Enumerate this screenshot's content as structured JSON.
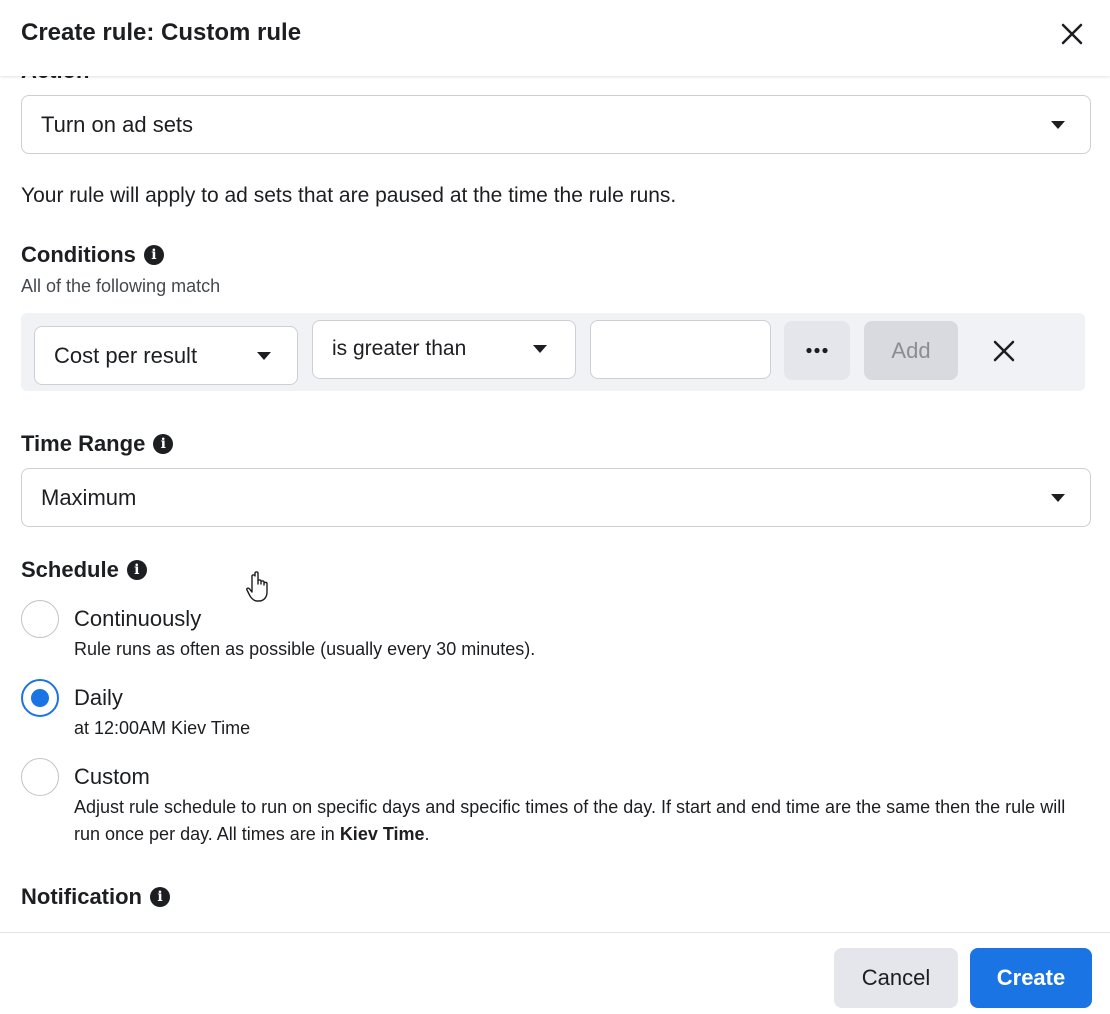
{
  "dialog": {
    "title": "Create rule: Custom rule",
    "section_cut_label": "Action"
  },
  "action": {
    "selected": "Turn on ad sets",
    "description": "Your rule will apply to ad sets that are paused at the time the rule runs."
  },
  "conditions": {
    "title": "Conditions",
    "subtitle": "All of the following match",
    "metric": "Cost per result",
    "operator": "is greater than",
    "value": "",
    "more_label": "•••",
    "add_label": "Add"
  },
  "time_range": {
    "title": "Time Range",
    "selected": "Maximum"
  },
  "schedule": {
    "title": "Schedule",
    "options": [
      {
        "label": "Continuously",
        "description": "Rule runs as often as possible (usually every 30 minutes).",
        "checked": false
      },
      {
        "label": "Daily",
        "description": "at 12:00AM Kiev Time",
        "checked": true
      },
      {
        "label": "Custom",
        "description_prefix": "Adjust rule schedule to run on specific days and specific times of the day. If start and end time are the same then the rule will run once per day. All times are in ",
        "description_bold": "Kiev Time",
        "description_suffix": ".",
        "checked": false
      }
    ]
  },
  "notification": {
    "title": "Notification"
  },
  "footer": {
    "cancel_label": "Cancel",
    "create_label": "Create"
  },
  "colors": {
    "primary": "#1b74e4",
    "text": "#1c1e21",
    "condition_bg": "#f0f2f5"
  },
  "icons": [
    "close-icon",
    "caret-down-icon",
    "info-icon",
    "more-icon",
    "remove-icon",
    "hand-cursor-icon"
  ]
}
